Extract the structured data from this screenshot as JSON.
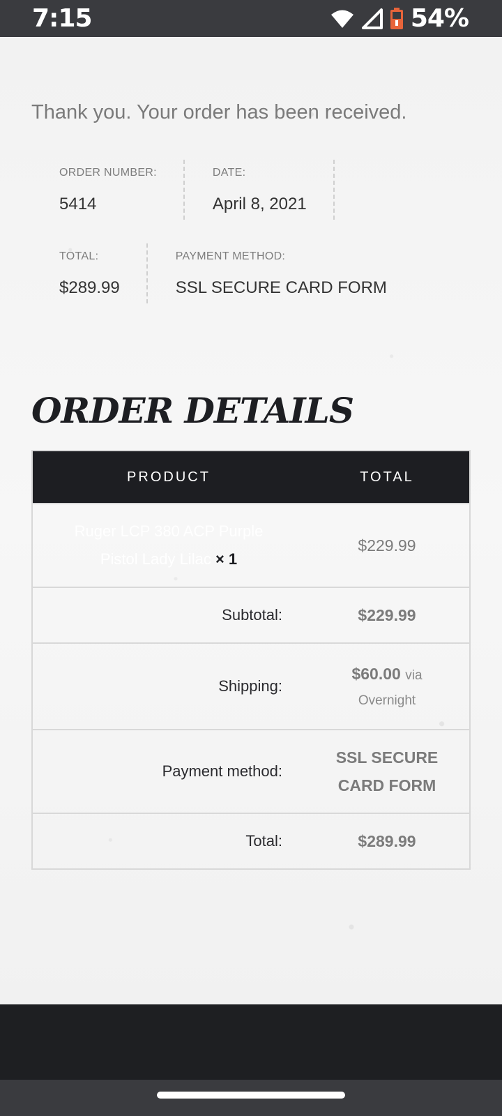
{
  "status_bar": {
    "time": "7:15",
    "battery": "54%"
  },
  "order": {
    "thank_you": "Thank you. Your order has been received.",
    "order_number_label": "ORDER NUMBER:",
    "order_number": "5414",
    "date_label": "DATE:",
    "date": "April 8, 2021",
    "total_label": "TOTAL:",
    "total": "$289.99",
    "payment_label": "PAYMENT METHOD:",
    "payment": "SSL SECURE CARD FORM"
  },
  "details": {
    "title": "ORDER DETAILS",
    "headers": {
      "product": "PRODUCT",
      "total": "TOTAL"
    },
    "item": {
      "name_line1": "Ruger LCP 380 ACP Purple",
      "name_line2": "Pistol Lady Lilac",
      "qty": "× 1",
      "price": "$229.99"
    },
    "subtotal_label": "Subtotal:",
    "subtotal": "$229.99",
    "shipping_label": "Shipping:",
    "shipping_amount": "$60.00",
    "shipping_via": "via",
    "shipping_method": "Overnight",
    "payment_label": "Payment method:",
    "payment_line1": "SSL SECURE",
    "payment_line2": "CARD FORM",
    "total_label": "Total:",
    "total": "$289.99"
  }
}
